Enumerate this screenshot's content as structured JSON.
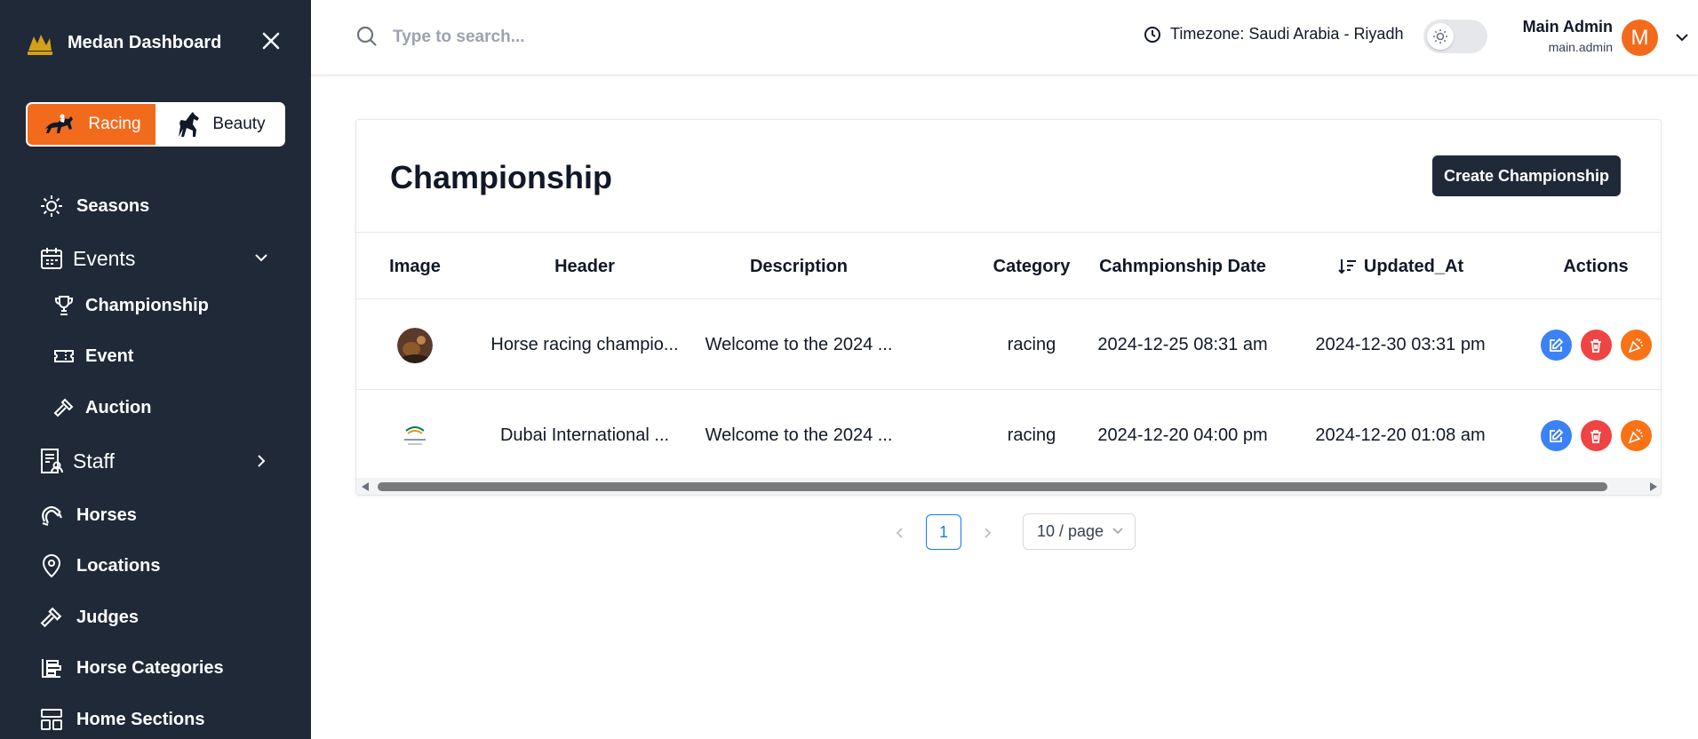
{
  "sidebar": {
    "brand_title": "Medan Dashboard",
    "switcher": {
      "active": "Racing",
      "inactive": "Beauty"
    },
    "items": [
      {
        "label": "Seasons",
        "icon": "sun-icon"
      },
      {
        "label": "Events",
        "icon": "calendar-icon",
        "expanded": true
      },
      {
        "label": "Championship",
        "icon": "trophy-icon"
      },
      {
        "label": "Event",
        "icon": "ticket-icon"
      },
      {
        "label": "Auction",
        "icon": "gavel-icon"
      },
      {
        "label": "Staff",
        "icon": "staff-icon",
        "expanded": false
      },
      {
        "label": "Horses",
        "icon": "horseshoe-icon"
      },
      {
        "label": "Locations",
        "icon": "location-pin-icon"
      },
      {
        "label": "Judges",
        "icon": "gavel-icon"
      },
      {
        "label": "Horse Categories",
        "icon": "categories-icon"
      },
      {
        "label": "Home Sections",
        "icon": "layout-icon"
      }
    ]
  },
  "topbar": {
    "search_placeholder": "Type to search...",
    "timezone": "Timezone: Saudi Arabia - Riyadh",
    "user_name": "Main Admin",
    "user_handle": "main.admin",
    "avatar_letter": "M"
  },
  "page": {
    "title": "Championship",
    "create_button": "Create Championship"
  },
  "table": {
    "columns": [
      "Image",
      "Header",
      "Description",
      "Category",
      "Cahmpionship Date",
      "Updated_At",
      "Actions"
    ],
    "rows": [
      {
        "header": "Horse racing champio...",
        "description": "Welcome to the 2024 ...",
        "category": "racing",
        "championship_date": "2024-12-25 08:31 am",
        "updated_at": "2024-12-30 03:31 pm"
      },
      {
        "header": "Dubai International ...",
        "description": "Welcome to the 2024 ...",
        "category": "racing",
        "championship_date": "2024-12-20 04:00 pm",
        "updated_at": "2024-12-20 01:08 am"
      }
    ]
  },
  "pagination": {
    "current_page": "1",
    "page_size": "10 / page"
  },
  "colors": {
    "sidebar_bg": "#1f2937",
    "accent": "#f26b1d",
    "edit": "#3b82f6",
    "delete": "#ef4444",
    "party": "#f97316"
  }
}
